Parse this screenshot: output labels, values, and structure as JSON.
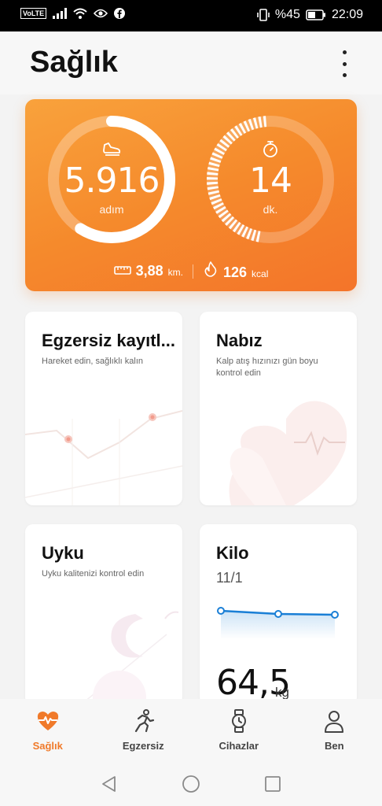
{
  "status_bar": {
    "volte": "VoLTE",
    "battery": "%45",
    "time": "22:09"
  },
  "header": {
    "title": "Sağlık"
  },
  "hero": {
    "steps_value": "5.916",
    "steps_unit": "adım",
    "steps_progress": 0.59,
    "time_value": "14",
    "time_unit": "dk.",
    "time_progress": 0.47,
    "distance_value": "3,88",
    "distance_unit": "km.",
    "calories_value": "126",
    "calories_unit": "kcal"
  },
  "cards": {
    "exercise": {
      "title": "Egzersiz kayıtl...",
      "subtitle": "Hareket edin, sağlıklı kalın"
    },
    "heart_rate": {
      "title": "Nabız",
      "subtitle_line1": "Kalp atış hızınızı gün boyu",
      "subtitle_line2": "kontrol edin"
    },
    "sleep": {
      "title": "Uyku",
      "subtitle": "Uyku kalitenizi kontrol edin"
    },
    "weight": {
      "title": "Kilo",
      "date": "11/1",
      "value": "64,5",
      "unit": "kg"
    }
  },
  "bottom_nav": {
    "items": [
      {
        "label": "Sağlık",
        "icon": "heart-pulse-icon",
        "active": true
      },
      {
        "label": "Egzersiz",
        "icon": "running-icon",
        "active": false
      },
      {
        "label": "Cihazlar",
        "icon": "watch-icon",
        "active": false
      },
      {
        "label": "Ben",
        "icon": "person-icon",
        "active": false
      }
    ]
  },
  "colors": {
    "accent": "#f07a2a",
    "hero_start": "#f9a23c",
    "hero_end": "#f4742a",
    "chart_line": "#1a7fd6"
  }
}
